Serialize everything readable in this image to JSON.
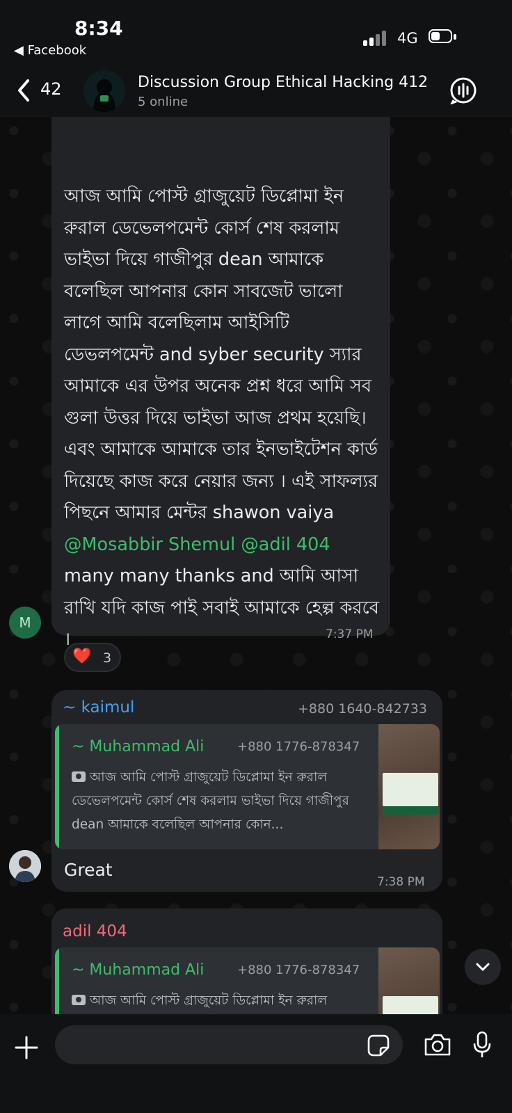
{
  "status_bar": {
    "time": "8:34",
    "back_app": "◀ Facebook",
    "network": "4G"
  },
  "header": {
    "unread_count": "42",
    "title": "Discussion Group Ethical Hacking 412",
    "status": "5 online"
  },
  "messages": [
    {
      "text_before": "আজ আমি পোস্ট গ্রাজুয়েট ডিপ্লোমা ইন রুরাল ডেভেলপমেন্ট কোর্স শেষ করলাম ভাইভা দিয়ে গাজীপুর dean আমাকে বলেছিল আপনার কোন সাবজেট ভালো লাগে আমি বলেছিলাম আইসিটি ডেভলপমেন্ট and syber security স্যার আমাকে এর উপর অনেক প্রশ্ন ধরে আমি সব গুলা উত্তর দিয়ে ভাইভা আজ প্রথম হয়েছি।এবং আমাকে আমাকে তার ইনভাইটেশন কার্ড দিয়েছে কাজ করে নেয়ার জন্য । এই সাফল্যর পিছনে আমার মেন্টর shawon vaiya ",
      "mention1": "@Mosabbir Shemul",
      "mention2": "@adil 404",
      "text_after": " many many thanks and আমি আসা রাখি যদি কাজ পাই সবাই আমাকে হেল্প করবে ।",
      "time": "7:37 PM",
      "avatar_initial": "M",
      "reaction": "❤️",
      "reaction_count": "3"
    },
    {
      "sender": "~ kaimul",
      "sender_color": "#4a9ff5",
      "sender_phone": "+880 1640-842733",
      "quote_name": "~ Muhammad Ali",
      "quote_phone": "+880 1776-878347",
      "quote_text": "আজ আমি পোস্ট গ্রাজুয়েট ডিপ্লোমা ইন রুরাল ডেভেলপমেন্ট কোর্স শেষ করলাম ভাইভা দিয়ে গাজীপুর dean আমাকে বলেছিল আপনার কোন...",
      "text": "Great",
      "time": "7:38 PM"
    },
    {
      "sender": "adil 404",
      "sender_color": "#ef6b7b",
      "quote_name": "~ Muhammad Ali",
      "quote_phone": "+880 1776-878347",
      "quote_text": "আজ আমি পোস্ট গ্রাজুয়েট ডিপ্লোমা ইন রুরাল"
    }
  ],
  "input": {
    "placeholder": ""
  }
}
